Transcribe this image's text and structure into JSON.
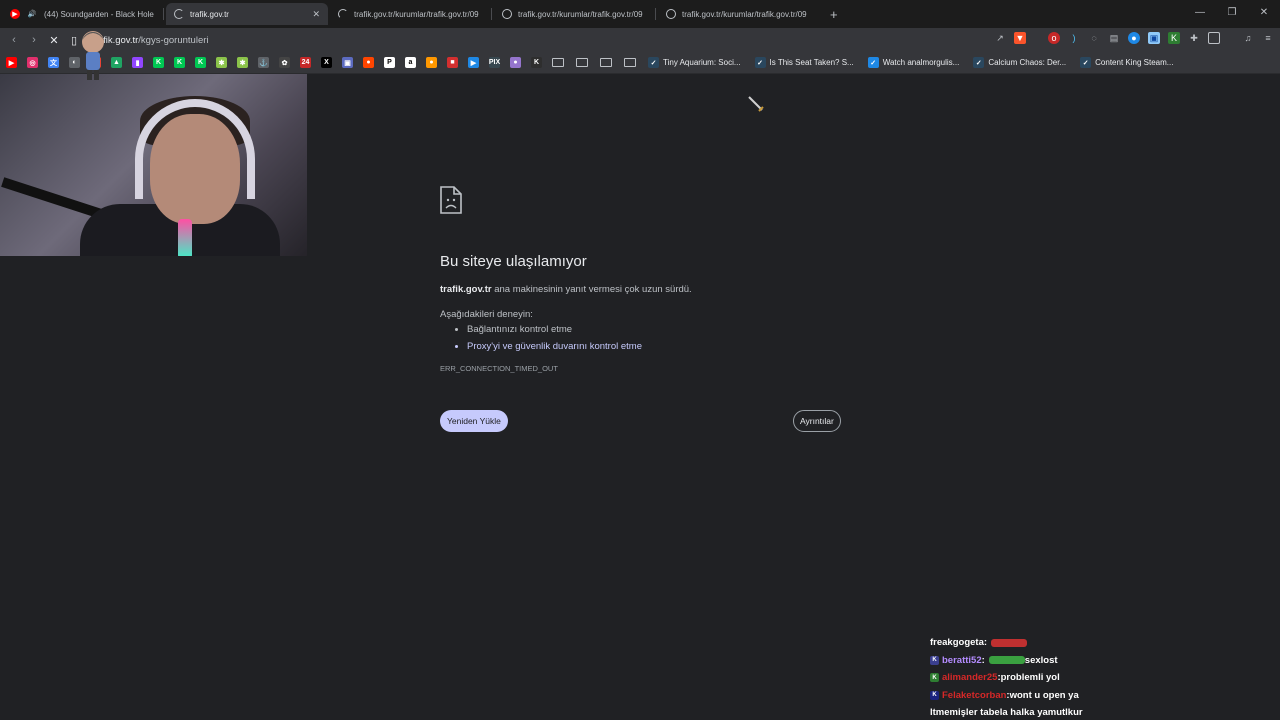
{
  "tabs": [
    {
      "title": "(44) Soundgarden - Black Hole S",
      "favicon_color": "#ff0000",
      "active": false,
      "audio": true
    },
    {
      "title": "trafik.gov.tr",
      "active": true,
      "loading": true
    },
    {
      "title": "trafik.gov.tr/kurumlar/trafik.gov.tr/09",
      "active": false,
      "loading": true
    },
    {
      "title": "trafik.gov.tr/kurumlar/trafik.gov.tr/09",
      "active": false
    },
    {
      "title": "trafik.gov.tr/kurumlar/trafik.gov.tr/09",
      "active": false
    }
  ],
  "new_tab_glyph": "+",
  "window_controls": {
    "minimize": "—",
    "maximize": "❐",
    "close": "✕"
  },
  "toolbar": {
    "url_host": "trafik.gov.tr",
    "url_path": "/kgys-goruntuleri"
  },
  "bookmarks": {
    "icons": [
      {
        "name": "youtube",
        "color": "#ff0000",
        "glyph": "▶"
      },
      {
        "name": "instagram",
        "color": "#e1306c",
        "glyph": "◎"
      },
      {
        "name": "translate",
        "color": "#4285f4",
        "glyph": "文"
      },
      {
        "name": "globe",
        "color": "#5f6368",
        "glyph": "◐"
      },
      {
        "name": "gmail",
        "color": "#ea4335",
        "glyph": "M"
      },
      {
        "name": "drive",
        "color": "#1fa463",
        "glyph": "▲"
      },
      {
        "name": "twitch",
        "color": "#9146ff",
        "glyph": "▮"
      },
      {
        "name": "kick",
        "color": "#00c853",
        "glyph": "K"
      },
      {
        "name": "kick",
        "color": "#00c853",
        "glyph": "K"
      },
      {
        "name": "kick",
        "color": "#00c853",
        "glyph": "K"
      },
      {
        "name": "app",
        "color": "#8bc34a",
        "glyph": "✱"
      },
      {
        "name": "app",
        "color": "#8bc34a",
        "glyph": "✱"
      },
      {
        "name": "anchor",
        "color": "#5f6368",
        "glyph": "⚓"
      },
      {
        "name": "app",
        "color": "#444444",
        "glyph": "✿"
      },
      {
        "name": "app",
        "color": "#c62828",
        "glyph": "24"
      },
      {
        "name": "x",
        "color": "#000000",
        "glyph": "X"
      },
      {
        "name": "app",
        "color": "#5c6bc0",
        "glyph": "▣"
      },
      {
        "name": "reddit",
        "color": "#ff4500",
        "glyph": "●"
      },
      {
        "name": "patreon",
        "color": "#ffffff",
        "glyph": "P"
      },
      {
        "name": "amazon",
        "color": "#ffffff",
        "glyph": "a"
      },
      {
        "name": "app",
        "color": "#ff9800",
        "glyph": "●"
      },
      {
        "name": "app",
        "color": "#d32f2f",
        "glyph": "■"
      },
      {
        "name": "app",
        "color": "#1e88e5",
        "glyph": "▶"
      },
      {
        "name": "app",
        "color": "#37474f",
        "glyph": "PIX"
      },
      {
        "name": "app",
        "color": "#9575cd",
        "glyph": "●"
      },
      {
        "name": "kick",
        "color": "#2e2e2e",
        "glyph": "K"
      }
    ],
    "folder_count": 4,
    "links": [
      {
        "label": "Tiny Aquarium: Soci...",
        "color": "#2a475e"
      },
      {
        "label": "Is This Seat Taken? S...",
        "color": "#2a475e"
      },
      {
        "label": "Watch analmorgulis...",
        "color": "#1e88e5"
      },
      {
        "label": "Calcium Chaos: Der...",
        "color": "#2a475e"
      },
      {
        "label": "Content King Steam...",
        "color": "#2a475e"
      }
    ]
  },
  "error_page": {
    "title": "Bu siteye ulaşılamıyor",
    "host": "trafik.gov.tr",
    "message": " ana makinesinin yanıt vermesi çok uzun sürdü.",
    "try_heading": "Aşağıdakileri deneyin:",
    "suggestions": [
      "Bağlantınızı kontrol etme",
      "Proxy'yi ve güvenlik duvarını kontrol etme"
    ],
    "error_code": "ERR_CONNECTION_TIMED_OUT",
    "reload_label": "Yeniden Yükle",
    "details_label": "Ayrıntılar"
  },
  "chat": [
    {
      "user": "freakgogeta",
      "user_color": "#ffffff",
      "sep": " :",
      "message": "",
      "badge": "",
      "emote_color": "#c03030"
    },
    {
      "user": "beratti52",
      "user_color": "#b48cff",
      "sep": " :",
      "message": " sexlost",
      "badge": "K",
      "badge_color": "#3a3f8f",
      "emote_color": "#3aa040"
    },
    {
      "user": "alimander25",
      "user_color": "#d62828",
      "sep": " :",
      "message": " problemli yol",
      "badge": "K",
      "badge_color": "#2e7d32"
    },
    {
      "user": "Felaketcorban",
      "user_color": "#d62828",
      "sep": " :",
      "message": " wont u open ya",
      "badge": "K",
      "badge_color": "#1a237e"
    },
    {
      "user": "",
      "user_color": "#ffffff",
      "sep": "",
      "message": "ltmemişler tabela halka yamutlkur",
      "badge": ""
    }
  ]
}
